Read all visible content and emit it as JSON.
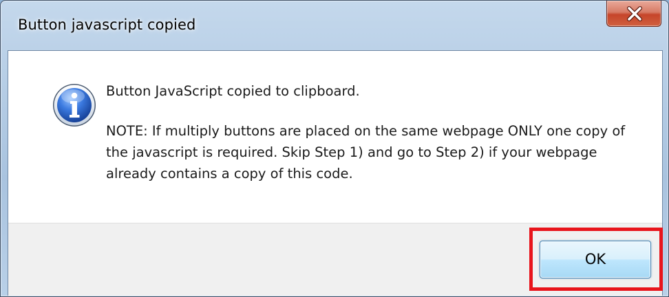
{
  "window": {
    "title": "Button javascript copied"
  },
  "dialog": {
    "icon": "info-icon",
    "message_main": "Button JavaScript copied to clipboard.",
    "message_note": "NOTE: If multiply buttons are placed on the same webpage ONLY one copy of the javascript is required. Skip Step 1) and go to Step 2) if your webpage already contains a copy of this code."
  },
  "buttons": {
    "ok_label": "OK",
    "close_icon": "close-icon"
  },
  "colors": {
    "highlight": "#e8141b",
    "icon_blue": "#2a62c0",
    "close_red": "#c6452a"
  }
}
